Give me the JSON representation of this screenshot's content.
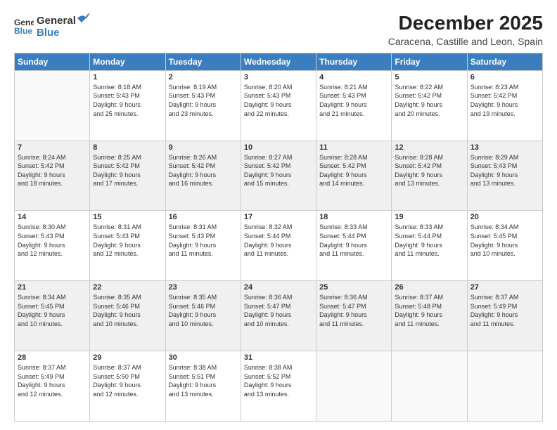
{
  "logo": {
    "general": "General",
    "blue": "Blue"
  },
  "title": "December 2025",
  "location": "Caracena, Castille and Leon, Spain",
  "weekdays": [
    "Sunday",
    "Monday",
    "Tuesday",
    "Wednesday",
    "Thursday",
    "Friday",
    "Saturday"
  ],
  "weeks": [
    {
      "shaded": false,
      "days": [
        {
          "num": "",
          "info": ""
        },
        {
          "num": "1",
          "info": "Sunrise: 8:18 AM\nSunset: 5:43 PM\nDaylight: 9 hours\nand 25 minutes."
        },
        {
          "num": "2",
          "info": "Sunrise: 8:19 AM\nSunset: 5:43 PM\nDaylight: 9 hours\nand 23 minutes."
        },
        {
          "num": "3",
          "info": "Sunrise: 8:20 AM\nSunset: 5:43 PM\nDaylight: 9 hours\nand 22 minutes."
        },
        {
          "num": "4",
          "info": "Sunrise: 8:21 AM\nSunset: 5:43 PM\nDaylight: 9 hours\nand 21 minutes."
        },
        {
          "num": "5",
          "info": "Sunrise: 8:22 AM\nSunset: 5:42 PM\nDaylight: 9 hours\nand 20 minutes."
        },
        {
          "num": "6",
          "info": "Sunrise: 8:23 AM\nSunset: 5:42 PM\nDaylight: 9 hours\nand 19 minutes."
        }
      ]
    },
    {
      "shaded": true,
      "days": [
        {
          "num": "7",
          "info": "Sunrise: 8:24 AM\nSunset: 5:42 PM\nDaylight: 9 hours\nand 18 minutes."
        },
        {
          "num": "8",
          "info": "Sunrise: 8:25 AM\nSunset: 5:42 PM\nDaylight: 9 hours\nand 17 minutes."
        },
        {
          "num": "9",
          "info": "Sunrise: 8:26 AM\nSunset: 5:42 PM\nDaylight: 9 hours\nand 16 minutes."
        },
        {
          "num": "10",
          "info": "Sunrise: 8:27 AM\nSunset: 5:42 PM\nDaylight: 9 hours\nand 15 minutes."
        },
        {
          "num": "11",
          "info": "Sunrise: 8:28 AM\nSunset: 5:42 PM\nDaylight: 9 hours\nand 14 minutes."
        },
        {
          "num": "12",
          "info": "Sunrise: 8:28 AM\nSunset: 5:42 PM\nDaylight: 9 hours\nand 13 minutes."
        },
        {
          "num": "13",
          "info": "Sunrise: 8:29 AM\nSunset: 5:43 PM\nDaylight: 9 hours\nand 13 minutes."
        }
      ]
    },
    {
      "shaded": false,
      "days": [
        {
          "num": "14",
          "info": "Sunrise: 8:30 AM\nSunset: 5:43 PM\nDaylight: 9 hours\nand 12 minutes."
        },
        {
          "num": "15",
          "info": "Sunrise: 8:31 AM\nSunset: 5:43 PM\nDaylight: 9 hours\nand 12 minutes."
        },
        {
          "num": "16",
          "info": "Sunrise: 8:31 AM\nSunset: 5:43 PM\nDaylight: 9 hours\nand 11 minutes."
        },
        {
          "num": "17",
          "info": "Sunrise: 8:32 AM\nSunset: 5:44 PM\nDaylight: 9 hours\nand 11 minutes."
        },
        {
          "num": "18",
          "info": "Sunrise: 8:33 AM\nSunset: 5:44 PM\nDaylight: 9 hours\nand 11 minutes."
        },
        {
          "num": "19",
          "info": "Sunrise: 8:33 AM\nSunset: 5:44 PM\nDaylight: 9 hours\nand 11 minutes."
        },
        {
          "num": "20",
          "info": "Sunrise: 8:34 AM\nSunset: 5:45 PM\nDaylight: 9 hours\nand 10 minutes."
        }
      ]
    },
    {
      "shaded": true,
      "days": [
        {
          "num": "21",
          "info": "Sunrise: 8:34 AM\nSunset: 5:45 PM\nDaylight: 9 hours\nand 10 minutes."
        },
        {
          "num": "22",
          "info": "Sunrise: 8:35 AM\nSunset: 5:46 PM\nDaylight: 9 hours\nand 10 minutes."
        },
        {
          "num": "23",
          "info": "Sunrise: 8:35 AM\nSunset: 5:46 PM\nDaylight: 9 hours\nand 10 minutes."
        },
        {
          "num": "24",
          "info": "Sunrise: 8:36 AM\nSunset: 5:47 PM\nDaylight: 9 hours\nand 10 minutes."
        },
        {
          "num": "25",
          "info": "Sunrise: 8:36 AM\nSunset: 5:47 PM\nDaylight: 9 hours\nand 11 minutes."
        },
        {
          "num": "26",
          "info": "Sunrise: 8:37 AM\nSunset: 5:48 PM\nDaylight: 9 hours\nand 11 minutes."
        },
        {
          "num": "27",
          "info": "Sunrise: 8:37 AM\nSunset: 5:49 PM\nDaylight: 9 hours\nand 11 minutes."
        }
      ]
    },
    {
      "shaded": false,
      "days": [
        {
          "num": "28",
          "info": "Sunrise: 8:37 AM\nSunset: 5:49 PM\nDaylight: 9 hours\nand 12 minutes."
        },
        {
          "num": "29",
          "info": "Sunrise: 8:37 AM\nSunset: 5:50 PM\nDaylight: 9 hours\nand 12 minutes."
        },
        {
          "num": "30",
          "info": "Sunrise: 8:38 AM\nSunset: 5:51 PM\nDaylight: 9 hours\nand 13 minutes."
        },
        {
          "num": "31",
          "info": "Sunrise: 8:38 AM\nSunset: 5:52 PM\nDaylight: 9 hours\nand 13 minutes."
        },
        {
          "num": "",
          "info": ""
        },
        {
          "num": "",
          "info": ""
        },
        {
          "num": "",
          "info": ""
        }
      ]
    }
  ]
}
